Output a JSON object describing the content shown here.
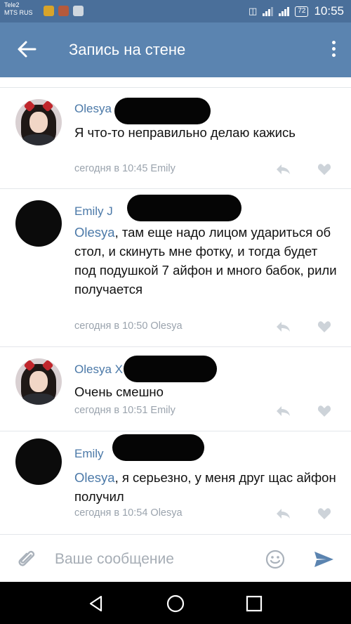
{
  "status_bar": {
    "carrier1": "Tele2",
    "carrier2": "MTS RUS",
    "battery": "72",
    "time": "10:55"
  },
  "app_bar": {
    "title": "Запись на стене"
  },
  "comments": [
    {
      "name": "Olesya",
      "text": "Я что-то неправильно делаю кажись",
      "meta": "сегодня в 10:45 Emily"
    },
    {
      "name": "Emily J",
      "mention": "Olesya",
      "text": ", там еще надо лицом удариться об стол, и скинуть мне фотку, и тогда будет под подушкой 7 айфон и много бабок, рили получается",
      "meta": "сегодня в 10:50 Olesya"
    },
    {
      "name": "Olesya X",
      "text": "Очень смешно",
      "meta": "сегодня в 10:51 Emily"
    },
    {
      "name": "Emily",
      "mention": "Olesya",
      "text": ", я серьезно, у меня друг щас айфон получил",
      "meta": "сегодня в 10:54 Olesya"
    }
  ],
  "composer": {
    "placeholder": "Ваше сообщение"
  },
  "colors": {
    "status_bar": "#4a6f9a",
    "app_bar": "#5b84b0",
    "link": "#4b79a8",
    "meta": "#9aa3ad"
  }
}
